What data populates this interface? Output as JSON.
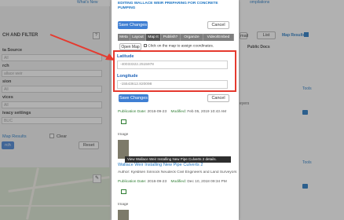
{
  "background": {
    "top_links": [
      "What's New",
      "ompilations"
    ],
    "left_panel": {
      "heading": "CH AND FILTER",
      "help": "?",
      "labels": [
        "ta Source",
        "rch",
        "sion",
        "vices",
        "ivacy settings"
      ],
      "field_values": [
        "All",
        "",
        "allace weir",
        "All",
        "All",
        "BLIC"
      ],
      "map_results_label": "Map Results",
      "clear_label": "Clear",
      "search_button": "rch",
      "reset_button": "Reset"
    },
    "right_col": {
      "mail_button": "mail",
      "list_button": "List",
      "map_results": "Map Results",
      "public_docs": "Public Docs",
      "partial_text": "eyers",
      "tools_label": "Tools"
    }
  },
  "modal": {
    "title_line1": "EDITING WALLACE WEIR PREPARING FOR CONCRETE",
    "title_line2": "PUMPING",
    "save_label": "Save Changes",
    "cancel_label": "Cancel",
    "tabs": [
      "Meta",
      "Layout",
      "Map It",
      "Publish?",
      "Organize",
      "Video/Embed"
    ],
    "active_tab": "Map It",
    "open_map_label": "Open Map",
    "map_hint": "Click on the map to assign coordinates.",
    "latitude_label": "Latitude",
    "latitude_value": "-40033322.2515978",
    "longitude_label": "Longitude",
    "longitude_value": "-15543612.820098",
    "publication_date_label": "Publication Date:",
    "publication_date": "2016-09-23",
    "modified_label": "Modified:",
    "modified_1": "Feb 05, 2019 10:43 AM",
    "image_label": "Image",
    "tooltip": "View Wallace Weir Installing New Pipe Culverts 2 details.",
    "doc2_title": "Wallace Weir Installing New Pipe Culverts 2",
    "author_line": "Author: Kjeldsen Sinnock Neudeck Civil Engineers and Land Surveyors",
    "modified_2": "Dec 10, 2018 09:34 PM",
    "image_label_2": "Image"
  },
  "colors": {
    "annotation_red": "#e53a2f",
    "primary_blue": "#3f7fd3"
  }
}
